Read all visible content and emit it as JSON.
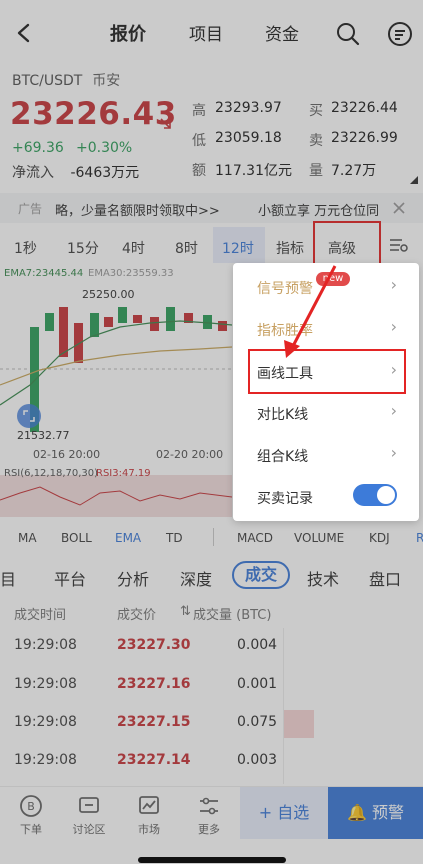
{
  "nav": {
    "tabs": [
      "报价",
      "项目",
      "资金"
    ]
  },
  "header": {
    "pair": "BTC/USDT",
    "exchange": "币安",
    "price": "23226.43",
    "change_abs": "+69.36",
    "change_pct": "+0.30%",
    "inflow_label": "净流入",
    "inflow_value": "-6463万元",
    "stats": {
      "high_label": "高",
      "high_value": "23293.97",
      "low_label": "低",
      "low_value": "23059.18",
      "amount_label": "额",
      "amount_value": "117.31亿元",
      "buy_label": "买",
      "buy_value": "23226.44",
      "sell_label": "卖",
      "sell_value": "23226.99",
      "vol_label": "量",
      "vol_value": "7.27万"
    }
  },
  "ad": {
    "tag": "广告",
    "left_text": "略，少量名额限时领取中>>",
    "right_text": "小额立享 万元仓位同"
  },
  "time_tabs": [
    "1秒",
    "15分",
    "4时",
    "8时",
    "12时",
    "指标",
    "高级"
  ],
  "chart": {
    "ema_label_7": "EMA7:23445.44",
    "ema_label_30": "EMA30:23559.33",
    "high_mark": "25250.00",
    "low_mark": "21532.77",
    "date_1": "02-16 20:00",
    "date_2": "02-20 20:00",
    "rsi_label": "RSI(6,12,18,70,30)",
    "rsi_value": "RSI3:47.19"
  },
  "indicators": [
    "MA",
    "BOLL",
    "EMA",
    "TD",
    "MACD",
    "VOLUME",
    "KDJ",
    "R"
  ],
  "sub_tabs": [
    "项目",
    "平台",
    "分析",
    "深度",
    "成交",
    "技术",
    "盘口"
  ],
  "trades": {
    "headers": [
      "成交时间",
      "成交价",
      "成交量 (BTC)"
    ],
    "rows": [
      {
        "time": "19:29:08",
        "price": "23227.30",
        "qty": "0.004"
      },
      {
        "time": "19:29:08",
        "price": "23227.16",
        "qty": "0.001"
      },
      {
        "time": "19:29:08",
        "price": "23227.15",
        "qty": "0.075"
      },
      {
        "time": "19:29:08",
        "price": "23227.14",
        "qty": "0.003"
      }
    ]
  },
  "bottom_bar": {
    "items": [
      "下单",
      "讨论区",
      "市场",
      "更多"
    ],
    "fav": "+ 自选",
    "alert": "预警"
  },
  "menu": {
    "items": [
      "信号预警",
      "指标胜率",
      "画线工具",
      "对比K线",
      "组合K线",
      "买卖记录"
    ],
    "new_badge": "new"
  }
}
